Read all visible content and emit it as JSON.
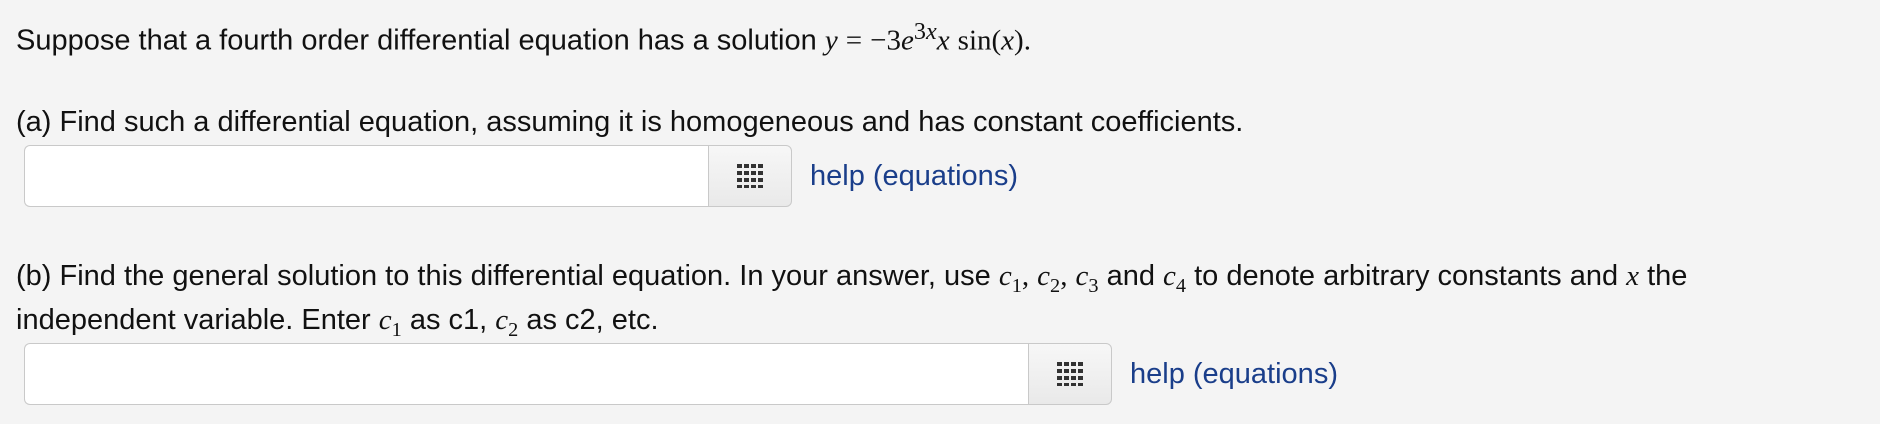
{
  "problem": {
    "intro": "Suppose that a fourth order differential equation has a solution",
    "solution": {
      "lhs": "y",
      "eq": "=",
      "coef": "−3",
      "base": "e",
      "exp_num": "3",
      "exp_var": "x",
      "var": "x",
      "func": "sin",
      "arg": "x",
      "end": "."
    }
  },
  "part_a": {
    "text": "(a) Find such a differential equation, assuming it is homogeneous and has constant coefficients.",
    "input_value": "",
    "help_label": "help (equations)"
  },
  "part_b": {
    "text_1": "(b) Find the general solution to this differential equation. In your answer, use",
    "c": "c",
    "s1": "1",
    "s2": "2",
    "s3": "3",
    "s4": "4",
    "comma": ",",
    "and": "and",
    "text_2": "to denote arbitrary constants and",
    "x": "x",
    "text_3": "the",
    "line2_a": "independent variable. Enter",
    "line2_b": "as c1,",
    "line2_c": "as c2, etc.",
    "input_value": "",
    "help_label": "help (equations)"
  },
  "icons": {
    "equation_editor": "grid-icon"
  },
  "colors": {
    "link": "#1a3e8a",
    "background": "#f4f4f4"
  }
}
